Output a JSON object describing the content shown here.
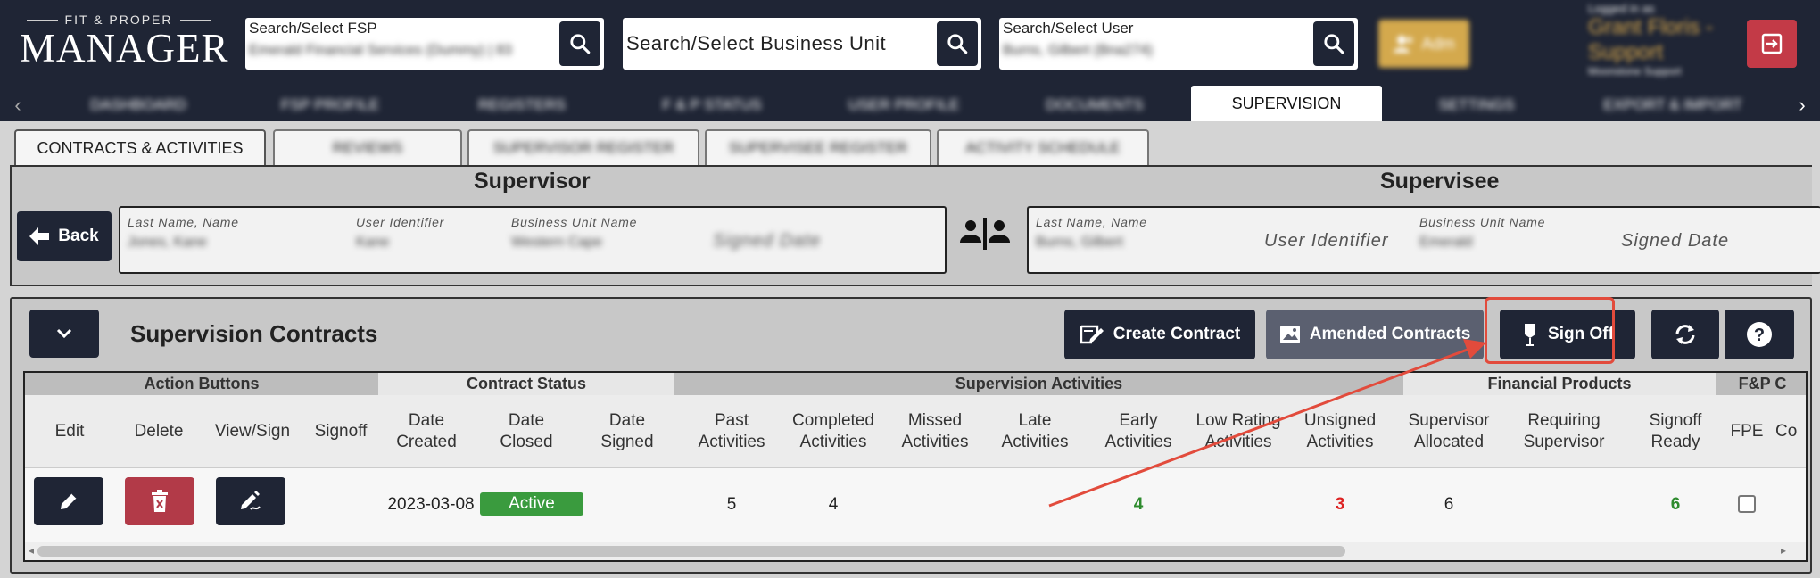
{
  "header": {
    "logo_small": "FIT & PROPER",
    "logo_big": "MANAGER",
    "fsp_search": {
      "label": "Search/Select FSP",
      "value": "Emerald Financial Services (Dummy) | 83"
    },
    "bu_search": {
      "placeholder": "Search/Select Business Unit"
    },
    "user_search": {
      "label": "Search/Select User",
      "value": "Burns, Gilbert (Bna274)"
    },
    "admin_label": "Adm",
    "logged_in_as": "Logged in as",
    "user_name": "Grant Floris - Support",
    "user_sub": "Moonstone Support"
  },
  "nav": {
    "items": [
      "DASHBOARD",
      "FSP PROFILE",
      "REGISTERS",
      "F & P STATUS",
      "USER PROFILE",
      "DOCUMENTS",
      "SUPERVISION",
      "SETTINGS",
      "EXPORT & IMPORT"
    ],
    "active": "SUPERVISION"
  },
  "subtabs": [
    "CONTRACTS & ACTIVITIES",
    "REVIEWS",
    "SUPERVISOR REGISTER",
    "SUPERVISEE REGISTER",
    "ACTIVITY SCHEDULE"
  ],
  "supervisor": {
    "title": "Supervisor",
    "back_label": "Back",
    "fields": [
      {
        "label": "Last Name, Name",
        "value": "Jones, Kane"
      },
      {
        "label": "User Identifier",
        "value": "Kane"
      },
      {
        "label": "Business Unit Name",
        "value": "Western Cape"
      }
    ],
    "signed_date": "Signed Date"
  },
  "supervisee": {
    "title": "Supervisee",
    "fields": [
      {
        "label": "Last Name, Name",
        "value": "Burns, Gilbert"
      },
      {
        "label": "Business Unit Name",
        "value": "Emerald"
      }
    ],
    "user_identifier": "User Identifier",
    "signed_date": "Signed Date"
  },
  "contracts": {
    "title": "Supervision Contracts",
    "buttons": {
      "create": "Create Contract",
      "amended": "Amended Contracts",
      "signoff": "Sign Off"
    },
    "groups": [
      "Action Buttons",
      "Contract Status",
      "Supervision Activities",
      "Financial Products",
      "F&P C"
    ],
    "columns": [
      "Edit",
      "Delete",
      "View/Sign",
      "Signoff",
      "Date Created",
      "Date Closed",
      "Date Signed",
      "Past Activities",
      "Completed Activities",
      "Missed Activities",
      "Late Activities",
      "Early Activities",
      "Low Rating Activities",
      "Unsigned Activities",
      "Supervisor Allocated",
      "Requiring Supervisor",
      "Signoff Ready",
      "FPE",
      "Co"
    ],
    "row": {
      "date_created": "2023-03-08",
      "status": "Active",
      "past": "5",
      "completed": "4",
      "early": "4",
      "unsigned": "3",
      "supervisor_allocated": "6",
      "signoff_ready": "6"
    }
  },
  "colors": {
    "navy": "#1f2535",
    "active_green": "#3a9b3e",
    "delete_red": "#b23a48",
    "highlight": "#e24b3c",
    "admin_gold": "#d4a94d"
  }
}
